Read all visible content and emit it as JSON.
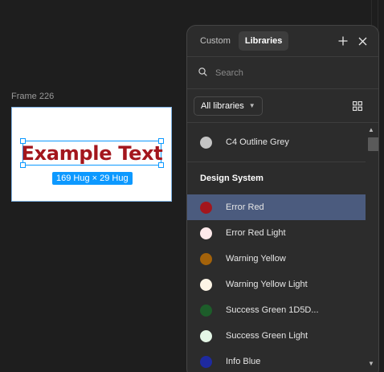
{
  "canvas": {
    "frame_label": "Frame 226",
    "text_content": "Example Text",
    "size_badge": "169 Hug × 29 Hug"
  },
  "panel": {
    "tabs": [
      {
        "label": "Custom",
        "active": false
      },
      {
        "label": "Libraries",
        "active": true
      }
    ],
    "search_placeholder": "Search",
    "filter_label": "All libraries",
    "top_items": [
      {
        "label": "C4 Outline Grey",
        "color": "#c4c4c4"
      }
    ],
    "section_title": "Design System",
    "items": [
      {
        "label": "Error Red",
        "color": "#a3161d",
        "selected": true
      },
      {
        "label": "Error Red Light",
        "color": "#fde9ea",
        "selected": false
      },
      {
        "label": "Warning Yellow",
        "color": "#a3620a",
        "selected": false
      },
      {
        "label": "Warning Yellow Light",
        "color": "#fdf5e6",
        "selected": false
      },
      {
        "label": "Success Green 1D5D...",
        "color": "#1d5d2a",
        "selected": false
      },
      {
        "label": "Success Green Light",
        "color": "#e4f6e6",
        "selected": false
      },
      {
        "label": "Info Blue",
        "color": "#1e2aa0",
        "selected": false
      }
    ]
  },
  "colors": {
    "selection_blue": "#0d99ff",
    "selected_row": "#4b5b7e"
  }
}
